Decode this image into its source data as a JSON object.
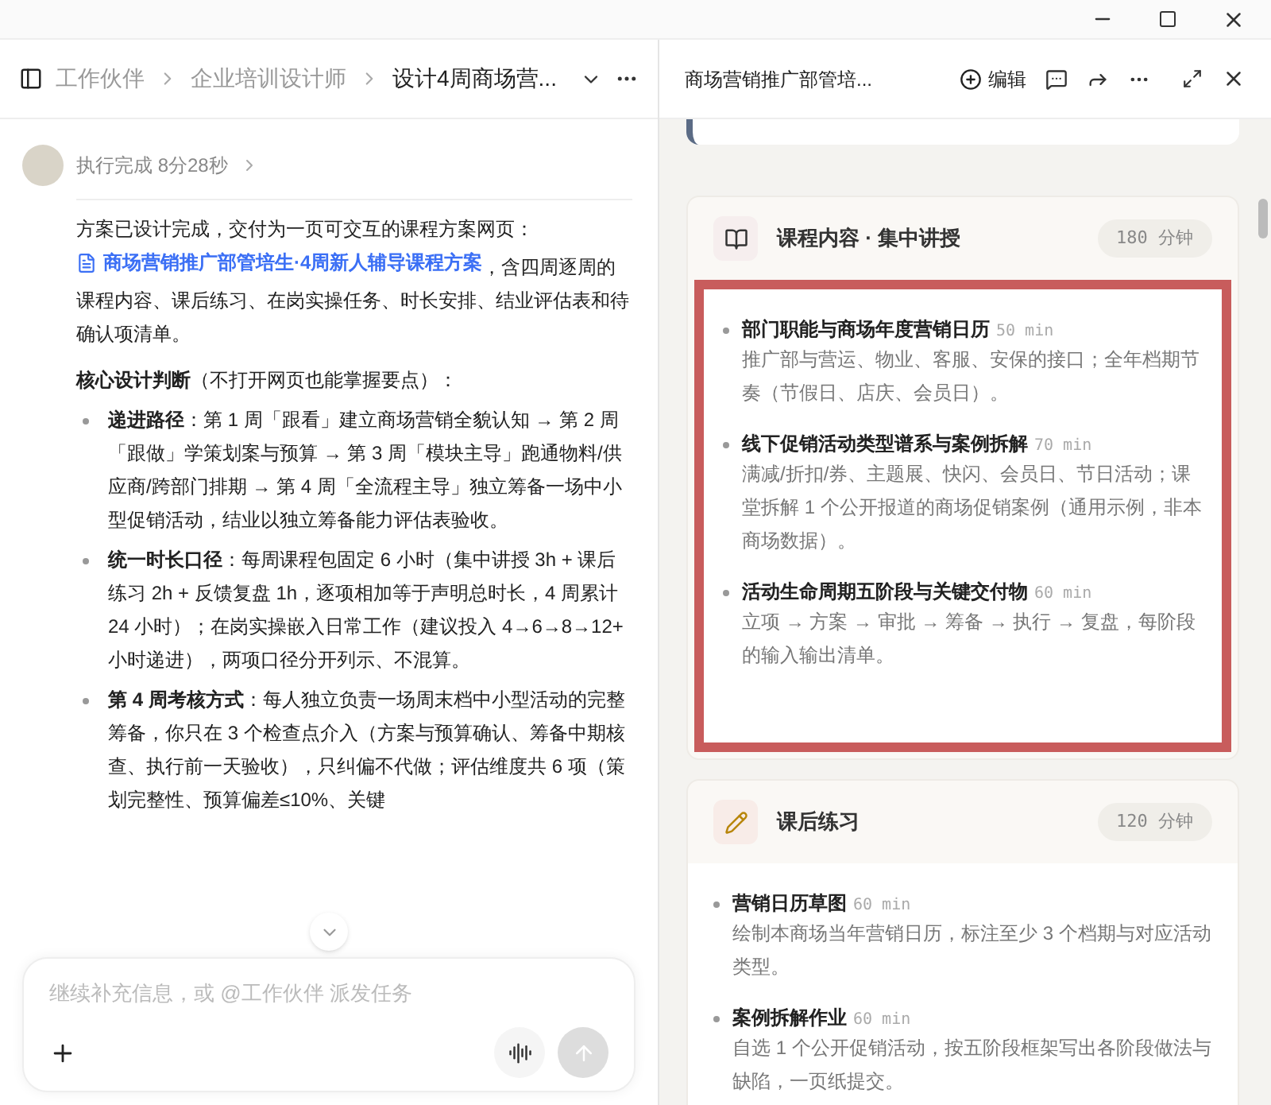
{
  "breadcrumb": {
    "items": [
      "工作伙伴",
      "企业培训设计师"
    ],
    "current": "设计4周商场营..."
  },
  "message": {
    "status": "执行完成 8分28秒",
    "intro_before": "方案已设计完成，交付为一页可交互的课程方案网页：",
    "link": "商场营销推广部管培生·4周新人辅导课程方案",
    "intro_after": "，含四周逐周的课程内容、课后练习、在岗实操任务、时长安排、结业评估表和待确认项清单。",
    "heading": "**核心设计判断**（不打开网页也能掌握要点）：",
    "bullets": [
      "**递进路径**：第 1 周「跟看」建立商场营销全貌认知 → 第 2 周「跟做」学策划案与预算 → 第 3 周「模块主导」跑通物料/供应商/跨部门排期 → 第 4 周「全流程主导」独立筹备一场中小型促销活动，结业以独立筹备能力评估表验收。",
      "**统一时长口径**：每周课程包固定 6 小时（集中讲授 3h + 课后练习 2h + 反馈复盘 1h，逐项相加等于声明总时长，4 周累计 24 小时）；在岗实操嵌入日常工作（建议投入 4→6→8→12+ 小时递进），两项口径分开列示、不混算。",
      "**第 4 周考核方式**：每人独立负责一场周末档中小型活动的完整筹备，你只在 3 个检查点介入（方案与预算确认、筹备中期核查、执行前一天验收），只纠偏不代做；评估维度共 6 项（策划完整性、预算偏差≤10%、关键"
    ]
  },
  "input": {
    "placeholder": "继续补充信息，或 @工作伙伴 派发任务"
  },
  "panel": {
    "title": "商场营销推广部管培...",
    "edit_label": "编辑",
    "sections": [
      {
        "kind": "book",
        "title": "课程内容 · 集中讲授",
        "badge": "180 分钟",
        "highlighted": true,
        "items": [
          {
            "title": "部门职能与商场年度营销日历",
            "duration": "50 min",
            "desc": "推广部与营运、物业、客服、安保的接口；全年档期节奏（节假日、店庆、会员日）。"
          },
          {
            "title": "线下促销活动类型谱系与案例拆解",
            "duration": "70 min",
            "desc": "满减/折扣/券、主题展、快闪、会员日、节日活动；课堂拆解 1 个公开报道的商场促销案例（通用示例，非本商场数据）。"
          },
          {
            "title": "活动生命周期五阶段与关键交付物",
            "duration": "60 min",
            "desc": "立项 → 方案 → 审批 → 筹备 → 执行 → 复盘，每阶段的输入输出清单。"
          }
        ]
      },
      {
        "kind": "pencil",
        "title": "课后练习",
        "badge": "120 分钟",
        "highlighted": false,
        "items": [
          {
            "title": "营销日历草图",
            "duration": "60 min",
            "desc": "绘制本商场当年营销日历，标注至少 3 个档期与对应活动类型。"
          },
          {
            "title": "案例拆解作业",
            "duration": "60 min",
            "desc": "自选 1 个公开促销活动，按五阶段框架写出各阶段做法与缺陷，一页纸提交。"
          }
        ]
      }
    ]
  }
}
